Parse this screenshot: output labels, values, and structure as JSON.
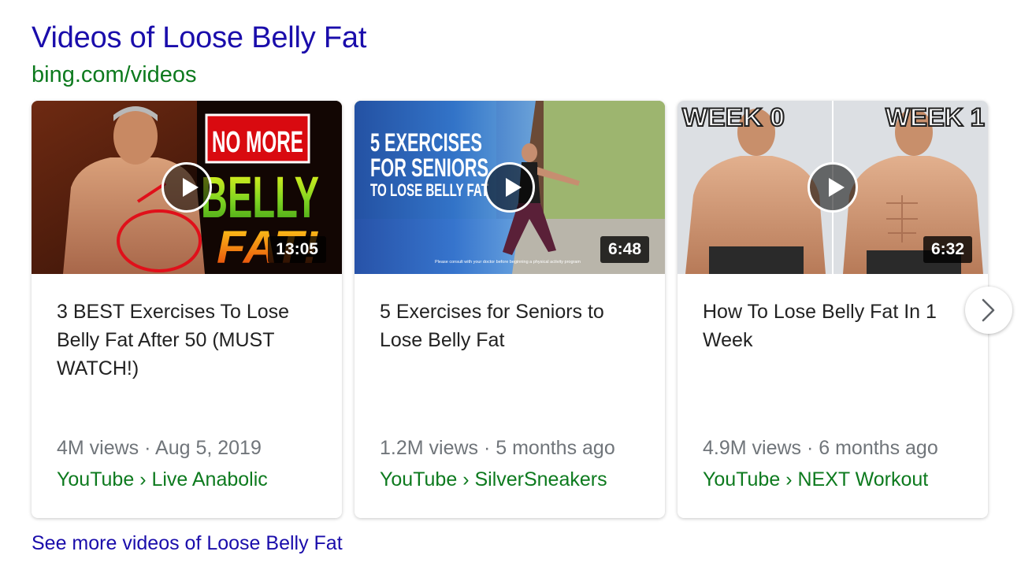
{
  "heading": "Videos of Loose Belly Fat",
  "source": "bing.com/videos",
  "cards": [
    {
      "title": "3 BEST Exercises To Lose Belly Fat After 50 (MUST WATCH!)",
      "duration": "13:05",
      "views_date": "4M views · Aug 5, 2019",
      "channel": "YouTube › Live Anabolic",
      "thumb_text": [
        "NO MORE",
        "BELLY",
        "FAT!"
      ]
    },
    {
      "title": "5 Exercises for Seniors to Lose Belly Fat",
      "duration": "6:48",
      "views_date": "1.2M views · 5 months ago",
      "channel": "YouTube › SilverSneakers",
      "thumb_text": [
        "5 EXERCISES",
        "FOR SENIORS",
        "TO LOSE BELLY FAT",
        "Please consult with your doctor before beginning a physical activity program"
      ]
    },
    {
      "title": "How To Lose Belly Fat In 1 Week",
      "duration": "6:32",
      "views_date": "4.9M views · 6 months ago",
      "channel": "YouTube › NEXT Workout",
      "thumb_text": [
        "WEEK 0",
        "WEEK 1"
      ]
    }
  ],
  "next_icon": "chevron-right-icon",
  "play_icon": "play-icon",
  "see_more": "See more videos of Loose Belly Fat",
  "colors": {
    "link": "#1a0dab",
    "source_green": "#0d7a1e",
    "meta_gray": "#70757a"
  }
}
